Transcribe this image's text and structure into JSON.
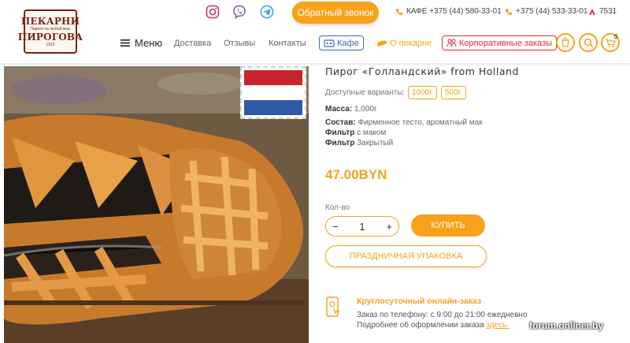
{
  "logo": {
    "line1": "ПЕКАРНИ",
    "line2": "ПИРОГОВА",
    "tagline": "Пироги на любой вкус",
    "year": "1919"
  },
  "header": {
    "social": [
      "instagram-icon",
      "viber-icon",
      "telegram-icon"
    ],
    "callback_label": "Обратный звонок",
    "phones": [
      {
        "label": "КАФЕ +375 (44) 580-33-01"
      },
      {
        "label": "+375 (44) 533-33-01"
      },
      {
        "label": "7531"
      }
    ]
  },
  "nav": {
    "menu_label": "Меню",
    "links": [
      "Доставка",
      "Отзывы",
      "Контакты"
    ],
    "cafe_label": "Кафе",
    "about_label": "О пекарне",
    "corporate_label": "Корпоративные заказы",
    "cart_count": "0"
  },
  "product": {
    "title": "Пирог «Голландский» from Holland",
    "variants_label": "Доступные варианты:",
    "variants": [
      "1000г.",
      "500г."
    ],
    "weight_label": "Масса:",
    "weight_value": "1,000г",
    "composition_label": "Состав:",
    "composition_value": "Фирменное тесто, ароматный мак",
    "filter1_label": "Фильтр",
    "filter1_value": "с маком",
    "filter2_label": "Фильтр",
    "filter2_value": "Закрытый",
    "price": "47.00BYN",
    "qty_label": "Кол-во",
    "qty_minus": "−",
    "qty_value": "1",
    "qty_plus": "+",
    "buy_label": "КУПИТЬ",
    "gift_label": "ПРАЗДНИЧНАЯ УПАКОВКА"
  },
  "order": {
    "title": "Круглосуточный онлайн-заказ",
    "line1": "Заказ по телефону: с 9:00 до 21:00 ежедневно",
    "line2_prefix": "Подробнее об оформлении заказа",
    "line2_link": "здесь."
  },
  "watermark": "forum.onliner.by",
  "colors": {
    "accent": "#f7a21a",
    "brand": "#7a2418",
    "cafe_blue": "#3a68c8",
    "corp_red": "#d9303a"
  }
}
